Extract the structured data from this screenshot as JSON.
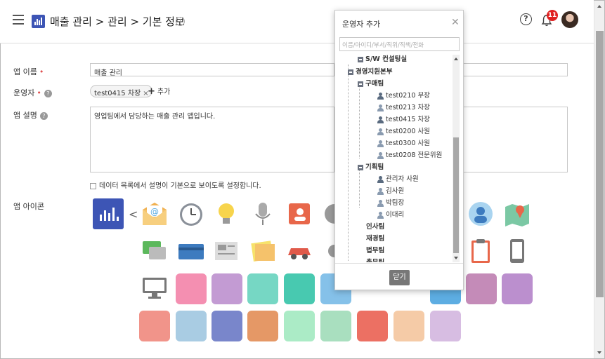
{
  "header": {
    "breadcrumb": "매출 관리 > 관리 > 기본 정보",
    "notification_count": "11"
  },
  "form": {
    "app_name_label": "앱 이름",
    "app_name_value": "매출 관리",
    "operator_label": "운영자",
    "operator_tag": "test0415 차장",
    "add_label": "추가",
    "description_label": "앱 설명",
    "description_value": "영업팀에서 담당하는 매출 관리 앱입니다.",
    "checkbox_label": "데이터 목록에서 설명이 기본으로 보이도록 설정합니다.",
    "icon_label": "앱 아이콘"
  },
  "icons": {
    "selected": "bar-chart-icon",
    "row1": [
      "mail-at-icon",
      "clock-icon",
      "lightbulb-icon",
      "microphone-icon",
      "contact-card-icon",
      "disc-icon",
      "group-icon",
      "map-icon"
    ],
    "row2": [
      "chat-icon",
      "credit-card-icon",
      "newspaper-icon",
      "memo-icon",
      "car-icon",
      "gear-icon",
      "clipboard-icon",
      "mobile-icon"
    ],
    "row3": [
      "monitor-icon",
      "inbox-icon",
      "line-chart-icon",
      "phone-icon",
      "car-front-icon",
      "people-icon",
      "upload-icon",
      "document-icon",
      "tools-icon",
      "lock-icon",
      "calendar-icon"
    ],
    "row4": [
      "mail-fast-icon",
      "checklist-icon",
      "bar-graph-icon",
      "ticket-icon",
      "film-icon",
      "speech-bubble-icon",
      "address-book-icon",
      "calculator-icon",
      "receipt-icon"
    ],
    "colors": {
      "selected": "#3d55b5",
      "pink": "#f48fb1",
      "lavender": "#c39bd3",
      "mint": "#76d7c4",
      "teal": "#48c9b0",
      "sky": "#85c1e9",
      "salmon": "#f1948a",
      "ocean": "#5dade2",
      "plum": "#c48bb8",
      "violet": "#bb8fce",
      "coral": "#e59866",
      "cyan": "#a9cce3",
      "indigo": "#7986cb",
      "orange": "#f8c471",
      "lime": "#abebc6",
      "light_green": "#a9dfbf",
      "rose": "#ec7063",
      "peach": "#f5cba7",
      "orchid": "#d7bde2"
    }
  },
  "dialog": {
    "title": "운영자 추가",
    "search_placeholder": "이름/아이디/부서/직위/직책/전화",
    "tree": {
      "partial_top": "S/W 컨설팅실",
      "division": "경영지원본부",
      "team1": "구매팀",
      "team1_members": [
        "test0210 부장",
        "test0213 차장",
        "test0415 차장",
        "test0200 사원",
        "test0300 사원",
        "test0208 전문위원"
      ],
      "team2": "기획팀",
      "team2_members": [
        "관리자 사원",
        "김사원",
        "박팀장",
        "이대리"
      ],
      "other_teams": [
        "인사팀",
        "재경팀",
        "법무팀",
        "총무팀"
      ]
    },
    "close_label": "닫기"
  }
}
